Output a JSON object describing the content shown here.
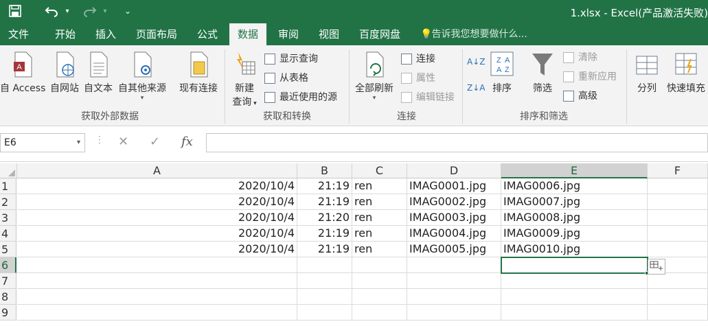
{
  "titlebar": {
    "title": "1.xlsx - Excel(产品激活失败)",
    "save_icon": "save-icon",
    "undo_icon": "undo-icon",
    "redo_icon": "redo-icon",
    "customize_icon": "customize-qat-icon"
  },
  "tabs": [
    "文件",
    "开始",
    "插入",
    "页面布局",
    "公式",
    "数据",
    "审阅",
    "视图",
    "百度网盘"
  ],
  "active_tab": "数据",
  "tell_me": "告诉我您想要做什么...",
  "ribbon": {
    "get_external": {
      "label": "获取外部数据",
      "buttons": [
        "自 Access",
        "自网站",
        "自文本",
        "自其他来源",
        "现有连接"
      ]
    },
    "get_transform": {
      "label": "获取和转换",
      "new_query_line1": "新建",
      "new_query_line2": "查询",
      "items": [
        "显示查询",
        "从表格",
        "最近使用的源"
      ]
    },
    "connections": {
      "label": "连接",
      "refresh_all": "全部刷新",
      "items": [
        "连接",
        "属性",
        "编辑链接"
      ]
    },
    "sort_filter": {
      "label": "排序和筛选",
      "sort": "排序",
      "filter": "筛选",
      "items": [
        "清除",
        "重新应用",
        "高级"
      ]
    },
    "data_tools": {
      "split": "分列",
      "flash_fill": "快速填充"
    }
  },
  "formula_bar": {
    "name_box": "E6",
    "cancel": "✕",
    "enter": "✓",
    "fx": "fx",
    "content": ""
  },
  "grid": {
    "columns": [
      "A",
      "B",
      "C",
      "D",
      "E",
      "F"
    ],
    "rows": [
      "1",
      "2",
      "3",
      "4",
      "5",
      "6",
      "7",
      "8",
      "9"
    ],
    "data": [
      [
        "2020/10/4",
        "21:19",
        "ren",
        "IMAG0001.jpg",
        "IMAG0006.jpg"
      ],
      [
        "2020/10/4",
        "21:19",
        "ren",
        "IMAG0002.jpg",
        "IMAG0007.jpg"
      ],
      [
        "2020/10/4",
        "21:20",
        "ren",
        "IMAG0003.jpg",
        "IMAG0008.jpg"
      ],
      [
        "2020/10/4",
        "21:19",
        "ren",
        "IMAG0004.jpg",
        "IMAG0009.jpg"
      ],
      [
        "2020/10/4",
        "21:19",
        "ren",
        "IMAG0005.jpg",
        "IMAG0010.jpg"
      ]
    ],
    "selected_cell": "E6"
  },
  "colors": {
    "accent": "#217346",
    "ribbon_bg": "#f3f3f3"
  }
}
